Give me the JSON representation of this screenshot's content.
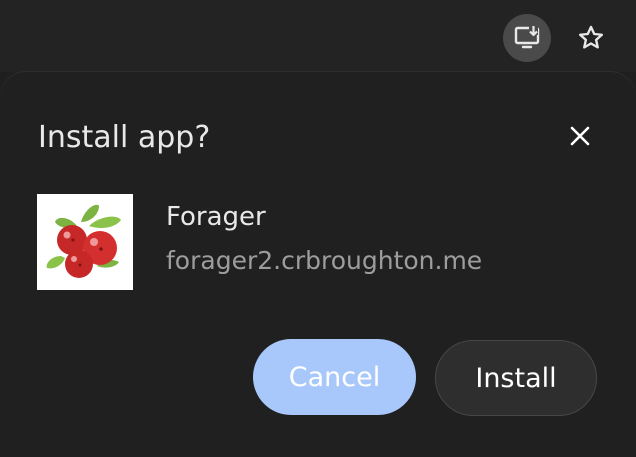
{
  "toolbar": {
    "install_icon": "install-desktop-icon",
    "star_icon": "star-outline-icon"
  },
  "dialog": {
    "title": "Install app?",
    "close_icon": "close-icon",
    "app": {
      "name": "Forager",
      "origin": "forager2.crbroughton.me",
      "icon": "berries-icon"
    },
    "buttons": {
      "cancel": "Cancel",
      "install": "Install"
    }
  },
  "colors": {
    "background": "#1f1f1f",
    "primary_button": "#a8c7fa",
    "secondary_button": "#2e2e2e",
    "text_primary": "#e8e8e8",
    "text_secondary": "#9d9d9d"
  }
}
